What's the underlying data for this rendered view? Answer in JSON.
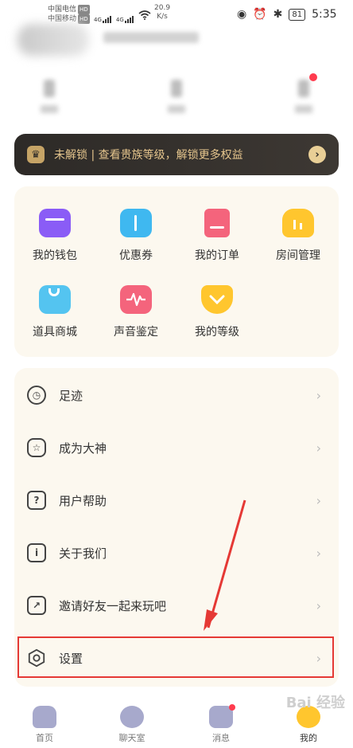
{
  "status_bar": {
    "carrier1": "中国电信",
    "carrier2": "中国移动",
    "hd": "HD",
    "net": "4G",
    "speed_value": "20.9",
    "speed_unit": "K/s",
    "battery": "81",
    "time": "5:35"
  },
  "banner": {
    "text": "未解锁 | 查看贵族等级，解锁更多权益"
  },
  "grid": [
    {
      "label": "我的钱包",
      "icon": "wallet-icon",
      "color": "#8a5cf6"
    },
    {
      "label": "优惠券",
      "icon": "coupon-icon",
      "color": "#3fb8f0"
    },
    {
      "label": "我的订单",
      "icon": "order-icon",
      "color": "#f4647c"
    },
    {
      "label": "房间管理",
      "icon": "room-icon",
      "color": "#ffc62e"
    },
    {
      "label": "道具商城",
      "icon": "shop-bag-icon",
      "color": "#54c4f0"
    },
    {
      "label": "声音鉴定",
      "icon": "voice-wave-icon",
      "color": "#f4647c"
    },
    {
      "label": "我的等级",
      "icon": "level-badge-icon",
      "color": "#ffc62e"
    }
  ],
  "menu": [
    {
      "label": "足迹",
      "icon": "clock-icon"
    },
    {
      "label": "成为大神",
      "icon": "star-jar-icon"
    },
    {
      "label": "用户帮助",
      "icon": "question-icon"
    },
    {
      "label": "关于我们",
      "icon": "info-icon"
    },
    {
      "label": "邀请好友一起来玩吧",
      "icon": "share-icon"
    },
    {
      "label": "设置",
      "icon": "hexagon-settings-icon"
    }
  ],
  "nav": [
    {
      "label": "首页"
    },
    {
      "label": "聊天室"
    },
    {
      "label": "消息"
    },
    {
      "label": "我的"
    }
  ],
  "watermark": "Bai 经验"
}
